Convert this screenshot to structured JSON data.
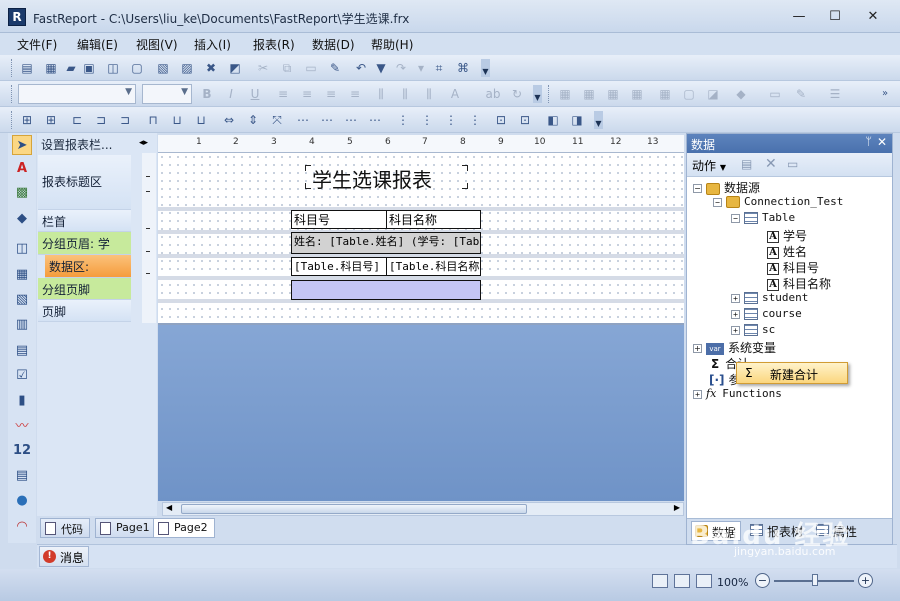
{
  "window": {
    "app_icon": "R",
    "title": "FastReport - C:\\Users\\liu_ke\\Documents\\FastReport\\学生选课.frx",
    "minimize": "—",
    "maximize": "☐",
    "close": "✕"
  },
  "menu": [
    "文件(F)",
    "编辑(E)",
    "视图(V)",
    "插入(I)",
    "报表(R)",
    "数据(D)",
    "帮助(H)"
  ],
  "bands": {
    "header": "设置报表栏...",
    "report_title": "报表标题区",
    "column_header": "栏首",
    "group_header": "分组页眉: 学",
    "data": "数据区:",
    "group_footer": "分组页脚",
    "page_footer": "页脚"
  },
  "ruler": [
    "1",
    "1",
    "2",
    "3",
    "4",
    "5",
    "6",
    "7",
    "8",
    "9",
    "10",
    "11",
    "12",
    "13"
  ],
  "report": {
    "title": "学生选课报表",
    "col1_header": "科目号",
    "col2_header": "科目名称",
    "group_text": "姓名: [Table.姓名] (学号: [Table.学号])",
    "data_col1": "[Table.科目号]",
    "data_col2": "[Table.科目名称]"
  },
  "page_tabs": [
    "代码",
    "Page1",
    "Page2"
  ],
  "messages_label": "消息",
  "status": {
    "zoom": "100%",
    "zoom_minus": "−",
    "zoom_plus": "+"
  },
  "data_panel": {
    "title": "数据",
    "pin": "ᛘ",
    "close": "✕",
    "action_label": "动作",
    "tree": {
      "datasources": "数据源",
      "connection": "Connection_Test",
      "table": "Table",
      "fields": [
        "学号",
        "姓名",
        "科目号",
        "科目名称"
      ],
      "other_tables": [
        "student",
        "course",
        "sc"
      ],
      "system_vars": "系统变量",
      "totals": "合计",
      "parameters": "参",
      "functions": "Functions"
    },
    "context_menu": "新建合计",
    "tabs": [
      "数据",
      "报表树",
      "属性"
    ]
  },
  "watermark": {
    "main": "Baidu 经验",
    "sub": "jingyan.baidu.com"
  },
  "colors": {
    "accent_header": "#4971ad",
    "data_band": "#f59c3c",
    "group_band": "#c7ea9c",
    "canvas_bg": "#6a8fc2"
  }
}
